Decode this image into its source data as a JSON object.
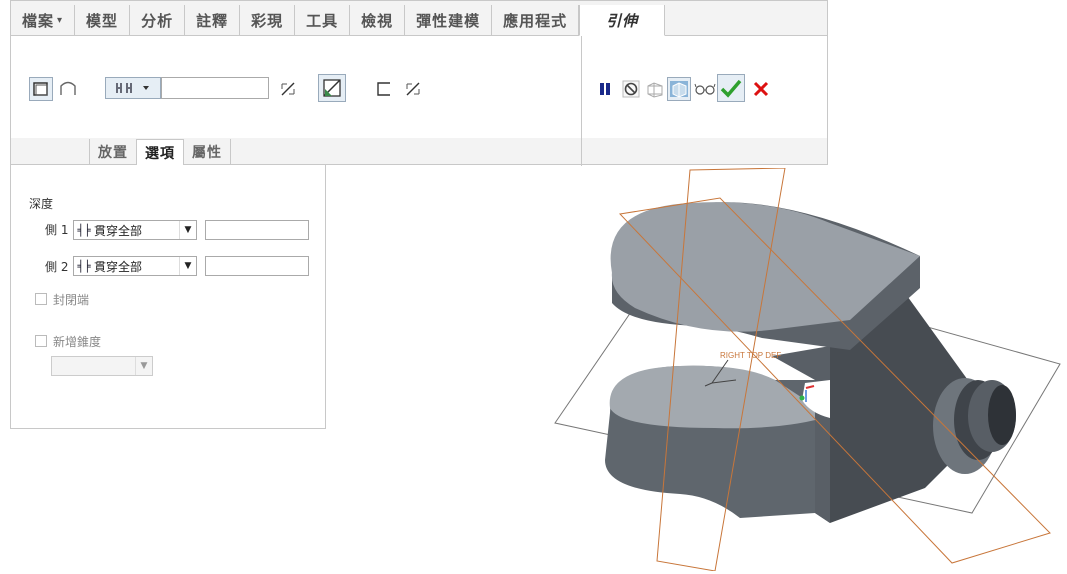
{
  "ribbon": {
    "tabs": [
      {
        "label": "檔案",
        "dropdown": true
      },
      {
        "label": "模型"
      },
      {
        "label": "分析"
      },
      {
        "label": "註釋"
      },
      {
        "label": "彩現"
      },
      {
        "label": "工具"
      },
      {
        "label": "檢視"
      },
      {
        "label": "彈性建模"
      },
      {
        "label": "應用程式"
      },
      {
        "label": "引伸",
        "active": true
      }
    ],
    "depth_value": "",
    "subtabs": [
      "放置",
      "選項",
      "屬性"
    ],
    "active_subtab": "選項"
  },
  "options": {
    "depth_label": "深度",
    "side1": {
      "label": "側 1",
      "option": "貫穿全部",
      "value": ""
    },
    "side2": {
      "label": "側 2",
      "option": "貫穿全部",
      "value": ""
    },
    "capped_ends": {
      "label": "封閉端",
      "checked": false
    },
    "add_taper": {
      "label": "新增錐度",
      "checked": false,
      "value": ""
    }
  },
  "viewport": {
    "datum_label": "RIGHT TOP DEF",
    "colors": {
      "datum": "#c8763a",
      "body": "#8c949c",
      "plane": "#666666"
    }
  }
}
